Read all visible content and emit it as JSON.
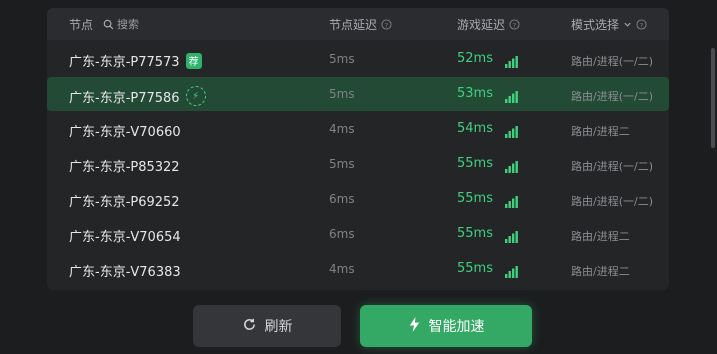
{
  "header": {
    "node": "节点",
    "search_placeholder": "搜索",
    "node_latency": "节点延迟",
    "game_latency": "游戏延迟",
    "mode_select": "模式选择"
  },
  "rows": [
    {
      "name": "广东-东京-P77573",
      "badge": "荐",
      "node_latency": "5ms",
      "game_latency": "52ms",
      "mode": "路由/进程(一/二)"
    },
    {
      "name": "广东-东京-P77586",
      "badge": "bolt",
      "node_latency": "5ms",
      "game_latency": "53ms",
      "mode": "路由/进程(一/二)",
      "selected": true
    },
    {
      "name": "广东-东京-V70660",
      "node_latency": "4ms",
      "game_latency": "54ms",
      "mode": "路由/进程二"
    },
    {
      "name": "广东-东京-P85322",
      "node_latency": "5ms",
      "game_latency": "55ms",
      "mode": "路由/进程(一/二)"
    },
    {
      "name": "广东-东京-P69252",
      "node_latency": "6ms",
      "game_latency": "55ms",
      "mode": "路由/进程(一/二)"
    },
    {
      "name": "广东-东京-V70654",
      "node_latency": "6ms",
      "game_latency": "55ms",
      "mode": "路由/进程二"
    },
    {
      "name": "广东-东京-V76383",
      "node_latency": "4ms",
      "game_latency": "55ms",
      "mode": "路由/进程二"
    }
  ],
  "buttons": {
    "refresh": "刷新",
    "accelerate": "智能加速"
  },
  "colors": {
    "accent": "#3fd17f",
    "selected_row": "#224a35",
    "button_green": "#33a965"
  }
}
